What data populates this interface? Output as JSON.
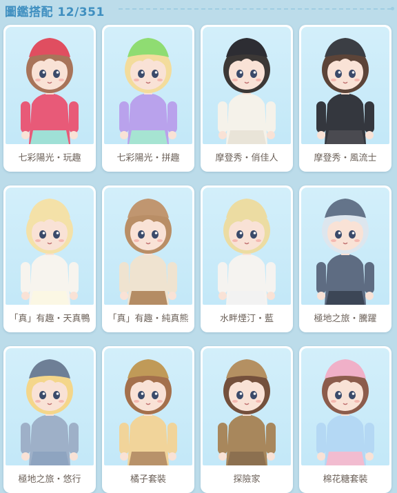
{
  "header": {
    "title": "圖鑑搭配 12/351"
  },
  "cards": [
    {
      "name": "七彩陽光・玩趣",
      "hair": "#a8745a",
      "hat": "#e04e60",
      "top": "#e85a78",
      "bottom": "#9fe0d6",
      "skin": "#f9e2d6"
    },
    {
      "name": "七彩陽光・拼趣",
      "hair": "#f3dc9c",
      "hat": "#8fdc72",
      "top": "#b9a2ec",
      "bottom": "#a6e4d2",
      "skin": "#f9e2d6"
    },
    {
      "name": "摩登秀・俏佳人",
      "hair": "#3c3836",
      "hat": "#2d2d33",
      "top": "#f5f2ea",
      "bottom": "#e9e4d8",
      "skin": "#f9e2d6"
    },
    {
      "name": "摩登秀・風流士",
      "hair": "#5c4438",
      "hat": "#3b3e44",
      "top": "#34373e",
      "bottom": "#4a4a50",
      "skin": "#f9e2d6"
    },
    {
      "name": "「真」有趣・天真鴨",
      "hair": "#f4e1a8",
      "hat": "#f4e1a8",
      "top": "#f7f4ee",
      "bottom": "#fbf7e4",
      "skin": "#f9e2d6"
    },
    {
      "name": "「真」有趣・純真熊",
      "hair": "#b98e66",
      "hat": "#c09670",
      "top": "#efe3d0",
      "bottom": "#b48c64",
      "skin": "#f9e2d6"
    },
    {
      "name": "水畔煙汀・藍",
      "hair": "#ecdca2",
      "hat": "#ecdca2",
      "top": "#f5f3f0",
      "bottom": "#f2f2f2",
      "skin": "#f9e2d6"
    },
    {
      "name": "極地之旅・騰躍",
      "hair": "#dde6ee",
      "hat": "#64748a",
      "top": "#5e6c82",
      "bottom": "#3c4656",
      "skin": "#f9e2d6"
    },
    {
      "name": "極地之旅・悠行",
      "hair": "#f4d68a",
      "hat": "#6e7f96",
      "top": "#9eb0c8",
      "bottom": "#8ea4c0",
      "skin": "#f9e2d6"
    },
    {
      "name": "橘子套裝",
      "hair": "#a4704c",
      "hat": "#c09a58",
      "top": "#f1d49a",
      "bottom": "#b8926a",
      "skin": "#f9e2d6"
    },
    {
      "name": "探險家",
      "hair": "#74503c",
      "hat": "#b49062",
      "top": "#a8875c",
      "bottom": "#8c7050",
      "skin": "#f9e2d6"
    },
    {
      "name": "棉花糖套裝",
      "hair": "#8c5c4c",
      "hat": "#f0b0c8",
      "top": "#b4d8f4",
      "bottom": "#f2bcd0",
      "skin": "#f9e2d6"
    }
  ]
}
